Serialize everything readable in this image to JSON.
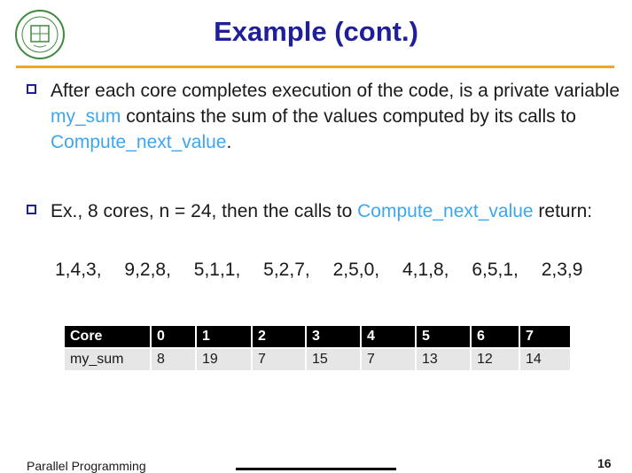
{
  "slide": {
    "title": "Example (cont.)",
    "bullets": [
      {
        "segments": [
          "After each core completes execution of the code, is a private variable ",
          "my_sum",
          " contains the sum of the values computed by its calls to ",
          "Compute_next_value",
          "."
        ]
      },
      {
        "segments": [
          "Ex., 8 cores, n = 24, then the calls to ",
          "Compute_next_value",
          " return:"
        ]
      }
    ],
    "sequence": [
      "1,4,3,",
      "9,2,8,",
      "5,1,1,",
      "5,2,7,",
      "2,5,0,",
      "4,1,8,",
      "6,5,1,",
      "2,3,9"
    ],
    "table": {
      "header": [
        "Core",
        "0",
        "1",
        "2",
        "3",
        "4",
        "5",
        "6",
        "7"
      ],
      "row": [
        "my_sum",
        "8",
        "19",
        "7",
        "15",
        "7",
        "13",
        "12",
        "14"
      ]
    },
    "footer": "Parallel Programming",
    "page_number": "16"
  },
  "colors": {
    "title": "#1f1f99",
    "highlight": "#3da6ee",
    "rule": "#f0a61a",
    "table_header_bg": "#000000",
    "table_body_bg": "#e6e6e6"
  },
  "icons": {
    "logo": "university-seal-logo",
    "bullet": "hollow-square-bullet"
  }
}
